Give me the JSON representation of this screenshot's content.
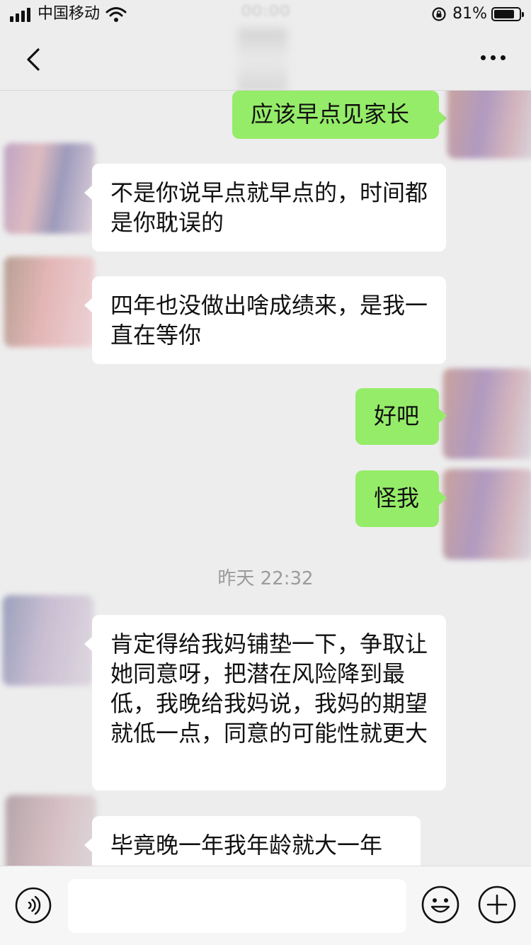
{
  "status_bar": {
    "carrier": "中国移动",
    "battery_percent": "81%",
    "battery_level": 0.81
  },
  "nav": {
    "back_icon": "chevron-left-icon",
    "more_icon": "more-dots-icon"
  },
  "messages": [
    {
      "side": "out",
      "text": "应该早点见家长"
    },
    {
      "side": "in",
      "text": "不是你说早点就早点的，时间都是你耽误的"
    },
    {
      "side": "in",
      "text": "四年也没做出啥成绩来，是我一直在等你"
    },
    {
      "side": "out",
      "text": "好吧"
    },
    {
      "side": "out",
      "text": "怪我"
    },
    {
      "side": "in",
      "text": "肯定得给我妈铺垫一下，争取让她同意呀，把潜在风险降到最低，我晚给我妈说，我妈的期望就低一点，同意的可能性就更大"
    },
    {
      "side": "in",
      "text": "毕竟晚一年我年龄就大一年"
    }
  ],
  "timestamp": "昨天 22:32",
  "input_bar": {
    "voice_icon": "voice-icon",
    "message_value": "",
    "emoji_icon": "emoji-icon",
    "plus_icon": "plus-icon"
  },
  "colors": {
    "background": "#ededed",
    "outgoing_bubble": "#95ec69",
    "incoming_bubble": "#ffffff"
  }
}
